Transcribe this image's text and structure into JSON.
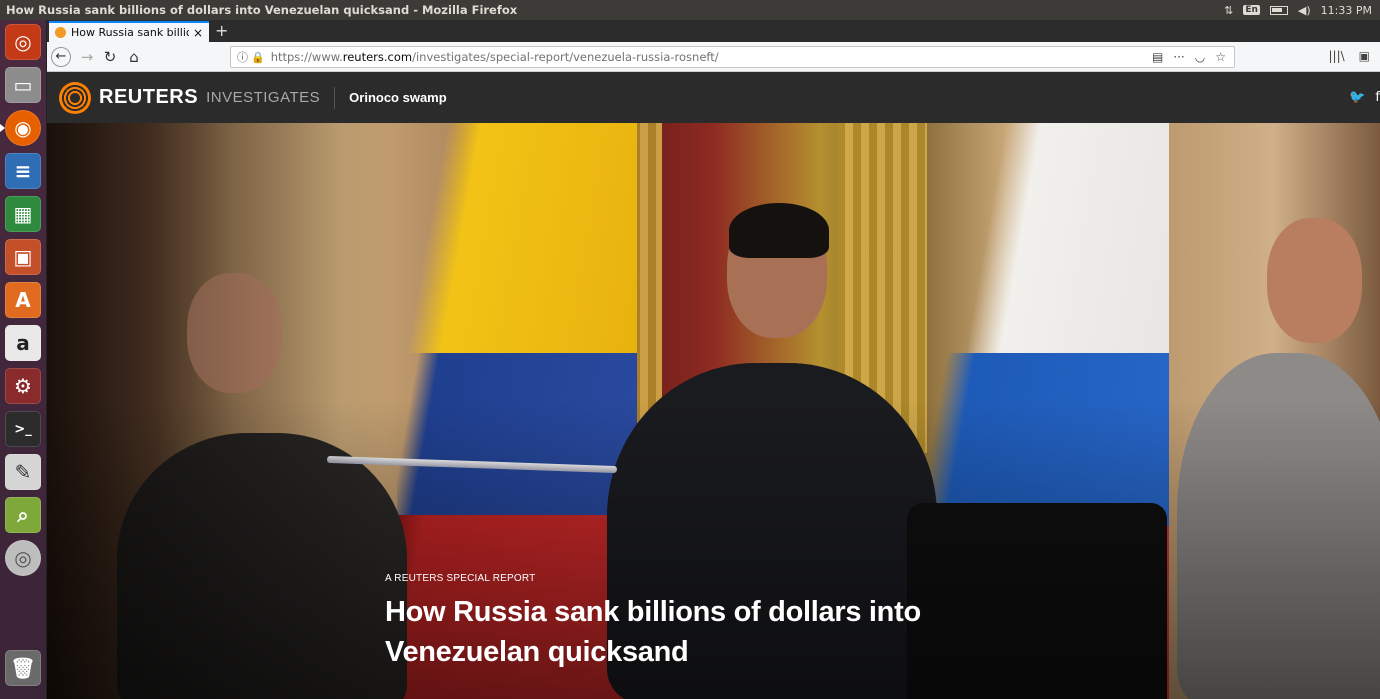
{
  "system": {
    "window_title": "How Russia sank billions of dollars into Venezuelan quicksand - Mozilla Firefox",
    "keyboard": "En",
    "clock": "11:33 PM"
  },
  "launcher": {
    "apps": [
      "ubuntu-logo-icon",
      "files-icon",
      "firefox-icon",
      "writer-icon",
      "calc-icon",
      "impress-icon",
      "software-center-icon",
      "amazon-icon",
      "settings-icon",
      "terminal-icon",
      "text-editor-icon",
      "image-viewer-icon",
      "dvd-icon",
      "trash-icon"
    ]
  },
  "browser": {
    "tab_title": "How Russia sank billion",
    "tab_close": "×",
    "new_tab": "+",
    "url_prefix": "https://www.",
    "url_domain": "reuters.com",
    "url_path": "/investigates/special-report/venezuela-russia-rosneft/"
  },
  "site": {
    "brand": "REUTERS",
    "section": "INVESTIGATES",
    "story_label": "Orinoco swamp"
  },
  "hero": {
    "kicker": "A REUTERS SPECIAL REPORT",
    "headline_line1": "How Russia sank billions of dollars into",
    "headline_line2": "Venezuelan quicksand"
  },
  "colors": {
    "reuters_orange": "#ff8000",
    "header_bg": "#2b2b2b",
    "firefox_accent": "#0a84ff"
  }
}
